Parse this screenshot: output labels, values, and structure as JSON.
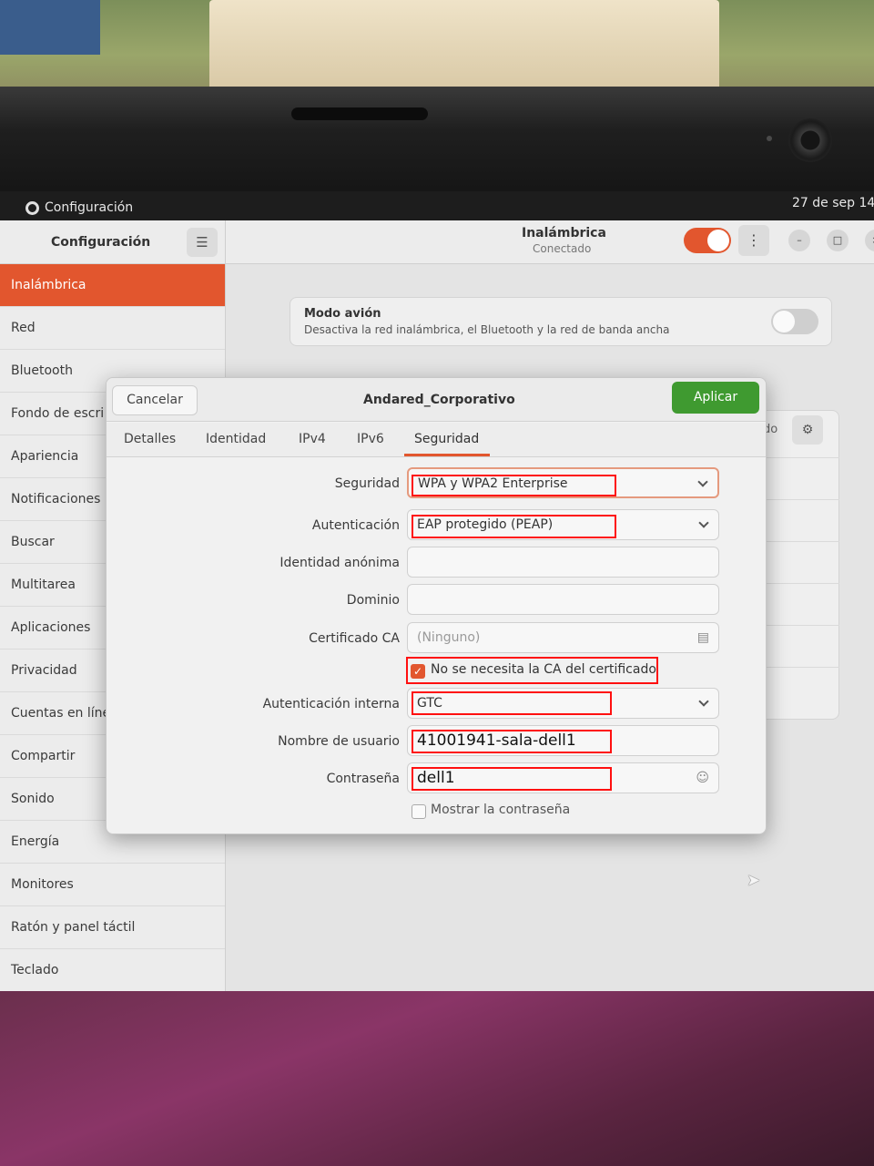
{
  "topbar": {
    "app_name": "Configuración",
    "clock": "27 de sep  14"
  },
  "sidebar": {
    "title": "Configuración",
    "menu_icon": "hamburger-icon",
    "items": [
      {
        "label": "Inalámbrica",
        "active": true
      },
      {
        "label": "Red"
      },
      {
        "label": "Bluetooth"
      },
      {
        "label": "Fondo de escri"
      },
      {
        "label": "Apariencia"
      },
      {
        "label": "Notificaciones"
      },
      {
        "label": "Buscar"
      },
      {
        "label": "Multitarea"
      },
      {
        "label": "Aplicaciones"
      },
      {
        "label": "Privacidad"
      },
      {
        "label": "Cuentas en líne"
      },
      {
        "label": "Compartir"
      },
      {
        "label": "Sonido"
      },
      {
        "label": "Energía"
      },
      {
        "label": "Monitores"
      },
      {
        "label": "Ratón y panel táctil"
      },
      {
        "label": "Teclado"
      }
    ]
  },
  "main": {
    "title": "Inalámbrica",
    "subtitle": "Conectado",
    "airplane": {
      "title": "Modo avión",
      "description": "Desactiva la red inalámbrica, el Bluetooth y la red de banda ancha"
    },
    "peek_text": "do"
  },
  "dialog": {
    "title": "Andared_Corporativo",
    "cancel_label": "Cancelar",
    "apply_label": "Aplicar",
    "tabs": [
      "Detalles",
      "Identidad",
      "IPv4",
      "IPv6",
      "Seguridad"
    ],
    "active_tab": "Seguridad",
    "fields": {
      "security": {
        "label": "Seguridad",
        "value": "WPA y WPA2 Enterprise"
      },
      "auth": {
        "label": "Autenticación",
        "value": "EAP protegido (PEAP)"
      },
      "anon_identity": {
        "label": "Identidad anónima",
        "value": ""
      },
      "domain": {
        "label": "Dominio",
        "value": ""
      },
      "ca_cert": {
        "label": "Certificado CA",
        "value": "(Ninguno)"
      },
      "no_ca": {
        "label": "No se necesita la CA del certificado",
        "checked": true
      },
      "inner_auth": {
        "label": "Autenticación interna",
        "value": "GTC"
      },
      "username": {
        "label": "Nombre de usuario",
        "value": "41001941-sala-dell1"
      },
      "password": {
        "label": "Contraseña",
        "value": "dell1"
      },
      "show_password": {
        "label": "Mostrar la contraseña",
        "checked": false
      }
    }
  },
  "colors": {
    "accent": "#e2562e",
    "apply": "#3f9a30",
    "highlight": "#ff1010"
  }
}
